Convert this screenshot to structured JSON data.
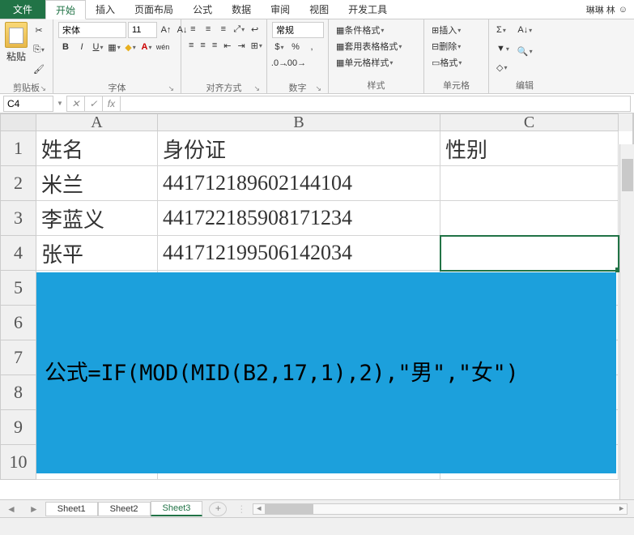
{
  "tabs": {
    "file": "文件",
    "items": [
      "开始",
      "插入",
      "页面布局",
      "公式",
      "数据",
      "审阅",
      "视图",
      "开发工具"
    ],
    "active": 0,
    "user": "琳琳 林"
  },
  "ribbon": {
    "clipboard": {
      "paste": "粘贴",
      "label": "剪贴板"
    },
    "font": {
      "name": "宋体",
      "size": "11",
      "label": "字体",
      "wen": "wén"
    },
    "align": {
      "label": "对齐方式"
    },
    "number": {
      "format": "常规",
      "label": "数字"
    },
    "styles": {
      "cond": "条件格式",
      "table": "套用表格格式",
      "cell": "单元格样式",
      "label": "样式"
    },
    "cells": {
      "insert": "插入",
      "delete": "删除",
      "format": "格式",
      "label": "单元格"
    },
    "editing": {
      "label": "编辑"
    }
  },
  "namebox": "C4",
  "columns": [
    "A",
    "B",
    "C"
  ],
  "rows": [
    "1",
    "2",
    "3",
    "4",
    "5",
    "6",
    "7",
    "8",
    "9",
    "10"
  ],
  "cells": {
    "A1": "姓名",
    "B1": "身份证",
    "C1": "性别",
    "A2": "米兰",
    "B2": "441712189602144104",
    "A3": "李蓝义",
    "B3": "441722185908171234",
    "A4": "张平",
    "B4": "441712199506142034"
  },
  "formula_overlay": "公式=IF(MOD(MID(B2,17,1),2),\"男\",\"女\")",
  "selected": "C4",
  "sheets": {
    "items": [
      "Sheet1",
      "Sheet2",
      "Sheet3"
    ],
    "active": 2
  }
}
